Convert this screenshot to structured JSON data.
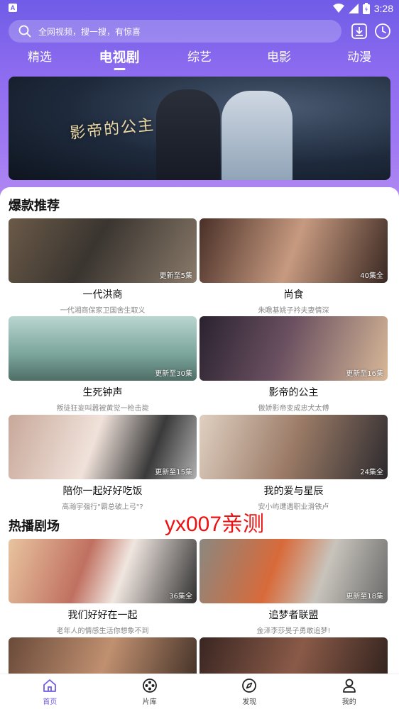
{
  "status_bar": {
    "time": "3:28",
    "left_badge": "A"
  },
  "search": {
    "placeholder": "全网视频，搜一搜，有惊喜"
  },
  "tabs": [
    {
      "label": "精选"
    },
    {
      "label": "电视剧"
    },
    {
      "label": "综艺"
    },
    {
      "label": "电影"
    },
    {
      "label": "动漫"
    }
  ],
  "active_tab": "电视剧",
  "banner": {
    "title": "影帝的公主"
  },
  "sections": {
    "hot": {
      "title": "爆款推荐"
    },
    "playing": {
      "title": "热播剧场"
    }
  },
  "cards": [
    {
      "title": "一代洪商",
      "desc": "一代湘商保家卫国舍生取义",
      "badge": "更新至5集"
    },
    {
      "title": "尚食",
      "desc": "朱瞻基姚子衿夫妻情深",
      "badge": "40集全"
    },
    {
      "title": "生死钟声",
      "desc": "叛徒狂妄叫嚣被黄觉一枪击毙",
      "badge": "更新至30集"
    },
    {
      "title": "影帝的公主",
      "desc": "傲娇影帝变成忠犬太傅",
      "badge": "更新至16集"
    },
    {
      "title": "陪你一起好好吃饭",
      "desc": "高瀚宇强行\"霸总破上弓\"?",
      "badge": "更新至15集"
    },
    {
      "title": "我的爱与星辰",
      "desc": "安小屿遭遇职业滑铁卢",
      "badge": "24集全"
    },
    {
      "title": "我们好好在一起",
      "desc": "老年人的情感生活你想象不到",
      "badge": "36集全"
    },
    {
      "title": "追梦者联盟",
      "desc": "金泽李莎旻子勇敢追梦!",
      "badge": "更新至18集"
    }
  ],
  "watermark": "yx007亲测",
  "bottom_nav": [
    {
      "label": "首页"
    },
    {
      "label": "片库"
    },
    {
      "label": "发现"
    },
    {
      "label": "我的"
    }
  ],
  "colors": {
    "accent": "#6f5ce6",
    "header_top": "#6f5ce6",
    "header_bottom": "#b58cf3",
    "watermark": "#ee1111"
  }
}
